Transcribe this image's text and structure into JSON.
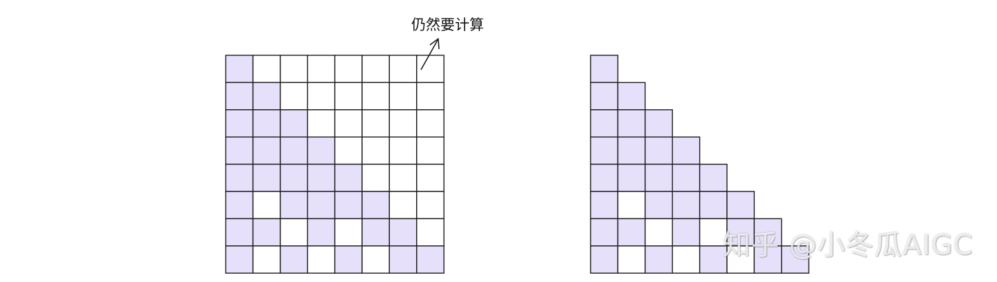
{
  "annotation": {
    "text": "仍然要计算"
  },
  "watermark": {
    "text": "知乎 @小冬瓜AIGC"
  },
  "colors": {
    "filled": "#e6e0fb",
    "empty": "#ffffff",
    "stroke": "#1a1a1a"
  },
  "left_grid": {
    "rows": [
      [
        1,
        0,
        0,
        0,
        0,
        0,
        0,
        0
      ],
      [
        1,
        1,
        0,
        0,
        0,
        0,
        0,
        0
      ],
      [
        1,
        1,
        1,
        0,
        0,
        0,
        0,
        0
      ],
      [
        1,
        1,
        1,
        1,
        0,
        0,
        0,
        0
      ],
      [
        1,
        1,
        1,
        1,
        1,
        0,
        0,
        0
      ],
      [
        1,
        0,
        1,
        1,
        1,
        1,
        0,
        0
      ],
      [
        1,
        1,
        0,
        1,
        0,
        1,
        1,
        0
      ],
      [
        1,
        0,
        1,
        0,
        1,
        0,
        1,
        1
      ]
    ]
  },
  "right_grid": {
    "rows": [
      [
        1
      ],
      [
        1,
        1
      ],
      [
        1,
        1,
        1
      ],
      [
        1,
        1,
        1,
        1
      ],
      [
        1,
        1,
        1,
        1,
        1
      ],
      [
        1,
        0,
        1,
        1,
        1,
        1
      ],
      [
        1,
        1,
        0,
        1,
        0,
        1,
        1
      ],
      [
        1,
        0,
        1,
        0,
        1,
        0,
        1,
        1
      ]
    ]
  }
}
